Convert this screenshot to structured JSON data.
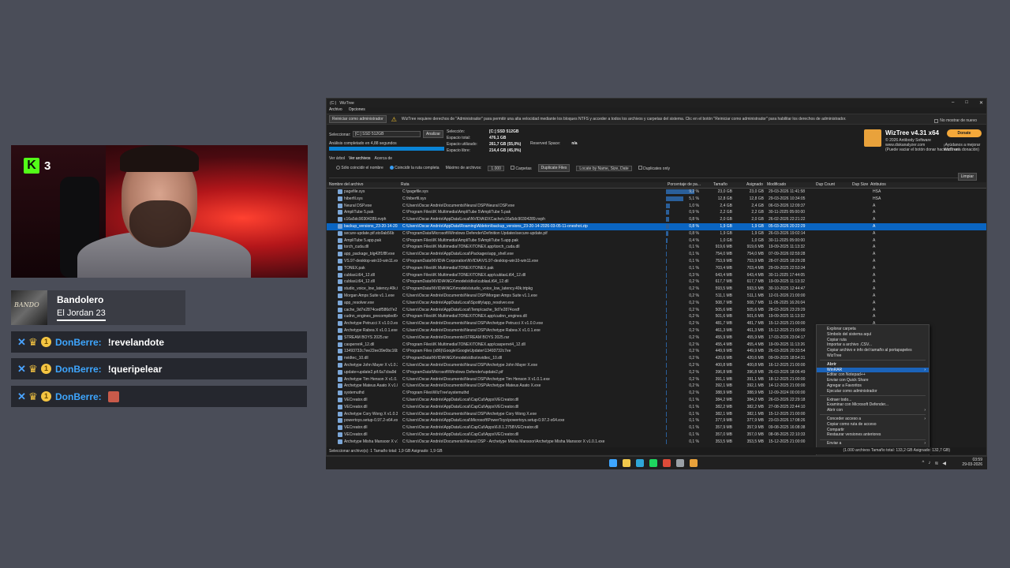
{
  "kick": {
    "count": "3",
    "logo": "K"
  },
  "music": {
    "title": "Bandolero",
    "artist": "El Jordan 23"
  },
  "chat": [
    {
      "user": "DonBerre:",
      "message": "!revelandote",
      "sub": "1"
    },
    {
      "user": "DonBerre:",
      "message": "!queripelear",
      "sub": "1"
    },
    {
      "user": "DonBerre:",
      "message": "",
      "sub": "1"
    }
  ],
  "window": {
    "title": "WizTree",
    "drive_short": "(C:)",
    "menu": [
      "Archivo",
      "Opciones"
    ],
    "admin_button": "Reiniciar como administrador",
    "admin_warning": "WizTree requiere derechos de \"Administrador\" para permitir una alta velocidad mediante los bloques NTFS y acceder a todos los archivos y carpetas del sistema. Clic en el botón \"Reiniciar como administrador\" para habilitar los derechos de administrador.",
    "no_show_again": "No mostrar de nuevo",
    "select_label": "Seleccionar:",
    "drive_value": "[C:] SSD 512GB",
    "analyze_button": "Analizar",
    "analysis_done": "Análisis completado en 4,88 segundos",
    "drive_info": [
      {
        "label": "Selección:",
        "value": "[C:] SSD 512GB"
      },
      {
        "label": "Espacio total:",
        "value": "476,1 GB"
      },
      {
        "label": "Espacio utilizado:",
        "value": "261,7 GB  (55,0%)"
      },
      {
        "label": "Espacio libre:",
        "value": "214,4 GB  (45,0%)"
      }
    ],
    "reserved_label": "Reserved Space:",
    "reserved_value": "n/a",
    "brand_title": "WizTree v4.31 x64",
    "brand_sub1": "© 2026 Antibody Software",
    "brand_sub2": "www.diskanalyzer.com",
    "brand_sub3": "(Puede vaciar el botón donar haciendo una donación)",
    "donate": "Donate",
    "donate_sub": "¡Ayúdanos a mejorar WizTree!",
    "tabs": [
      "Ver árbol",
      "Ver archivos",
      "Acerca de"
    ],
    "filter": {
      "only_name": "Sólo coincidir el nombre",
      "full_path": "Coincidir la ruta completa",
      "max_files_label": "Máximo de archivos:",
      "max_files": "1.000",
      "folders": "Carpetas",
      "duplicate_files": "Duplicate Files",
      "group_by": "Locate by Name, Size, Date",
      "only_duplicates": "Duplicates only"
    },
    "clear_button": "Limpiar",
    "columns": {
      "name": "Nombre del archivo",
      "path": "Ruta",
      "pct": "Porcentaje de pa...",
      "size": "Tamaño",
      "alloc": "Asignado",
      "modified": "Modificado",
      "dup": "Dup Count",
      "dupsize": "Dup Size",
      "attr": "Atributos"
    },
    "rows": [
      {
        "name": "pagefile.sys",
        "path": "C:\\pagefile.sys",
        "pct": "9,2 %",
        "size": "23,0 GB",
        "alloc": "23,0 GB",
        "modified": "29-03-2026 11:41:58",
        "attr": "HSA",
        "bar": 0.9
      },
      {
        "name": "hiberfil.sys",
        "path": "C:\\hiberfil.sys",
        "pct": "5,1 %",
        "size": "12,8 GB",
        "alloc": "12,8 GB",
        "modified": "29-03-2026 10:34:05",
        "attr": "HSA",
        "bar": 0.55
      },
      {
        "name": "Neural DSP.exe",
        "path": "C:\\Users\\Oscar Andrés\\Documents\\Neural DSP\\Neural DSP.exe",
        "pct": "1,0 %",
        "size": "2,4 GB",
        "alloc": "2,4 GB",
        "modified": "06-03-2026 12:09:37",
        "attr": "A",
        "bar": 0.12
      },
      {
        "name": "AmpliTube 5.pak",
        "path": "C:\\Program Files\\IK Multimedia\\AmpliTube 5\\AmpliTube 5.pak",
        "pct": "0,9 %",
        "size": "2,2 GB",
        "alloc": "2,2 GB",
        "modified": "30-11-2025 05:00:00",
        "attr": "A",
        "bar": 0.1
      },
      {
        "name": "c16a5dc90304289.nvph",
        "path": "C:\\Users\\Oscar Andrés\\AppData\\Local\\NVIDIA\\DXCache\\c16a5dc90304289.nvph",
        "pct": "0,8 %",
        "size": "2,0 GB",
        "alloc": "2,0 GB",
        "modified": "26-02-2026 22:21:22",
        "attr": "A",
        "bar": 0.09
      },
      {
        "name": "backup_versions_23-20-14-2026.zip",
        "path": "C:\\Users\\Oscar Andrés\\AppData\\Roaming\\Ableton\\backup_versions_23-20-14-2026-03-05-11-oneshot.zip",
        "pct": "0,8 %",
        "size": "1,9 GB",
        "alloc": "1,9 GB",
        "modified": "05-03-2026 20:22:29",
        "attr": "A",
        "bar": 0.09,
        "selected": true
      },
      {
        "name": "secure-update.pif.sto9ab56b",
        "path": "C:\\ProgramData\\Microsoft\\Windows Defender\\Definition Updates\\secure-update.pif",
        "pct": "0,8 %",
        "size": "1,9 GB",
        "alloc": "1,9 GB",
        "modified": "26-03-2026 19:02:14",
        "attr": "A",
        "bar": 0.08
      },
      {
        "name": "AmpliTube 5.app.pak",
        "path": "C:\\Program Files\\IK Multimedia\\AmpliTube 5\\AmpliTube 5.app.pak",
        "pct": "0,4 %",
        "size": "1,0 GB",
        "alloc": "1,0 GB",
        "modified": "30-11-2025 05:00:00",
        "attr": "A",
        "bar": 0.05
      },
      {
        "name": "torch_cuda.dll",
        "path": "C:\\Program Files\\IK Multimedia\\TONEX\\TONEX.app\\torch_cuda.dll",
        "pct": "0,1 %",
        "size": "919,6 MB",
        "alloc": "919,6 MB",
        "modified": "19-09-2025 11:13:32",
        "attr": "A",
        "bar": 0.03
      },
      {
        "name": "app_package_blg42f1f8f.exe",
        "path": "C:\\Users\\Oscar Andrés\\AppData\\Local\\Packages\\app_shell.exe",
        "pct": "0,1 %",
        "size": "754,0 MB",
        "alloc": "754,0 MB",
        "modified": "07-09-2026 02:59:28",
        "attr": "A",
        "bar": 0.03
      },
      {
        "name": "VS.97-desktop-win10-win11.exe",
        "path": "C:\\ProgramData\\NVIDIA Corporation\\NVIDIA\\VS.97-desktop-win10-win11.exe",
        "pct": "0,1 %",
        "size": "753,9 MB",
        "alloc": "753,9 MB",
        "modified": "28-07-2025 18:29:28",
        "attr": "A",
        "bar": 0.03
      },
      {
        "name": "TONEX.pak",
        "path": "C:\\Program Files\\IK Multimedia\\TONEX\\TONEX.pak",
        "pct": "0,1 %",
        "size": "703,4 MB",
        "alloc": "703,4 MB",
        "modified": "29-09-2025 22:53:34",
        "attr": "A",
        "bar": 0.03
      },
      {
        "name": "cublasLt64_12.dll",
        "path": "C:\\Program Files\\IK Multimedia\\TONEX\\TONEX.app\\cublasLt64_12.dll",
        "pct": "0,3 %",
        "size": "643,4 MB",
        "alloc": "643,4 MB",
        "modified": "30-11-2025 17:44:05",
        "attr": "A",
        "bar": 0.02
      },
      {
        "name": "cublasLt64_12.dll",
        "path": "C:\\ProgramData\\NVIDIA\\NGX\\models\\dlss\\cublasLt64_12.dll",
        "pct": "0,2 %",
        "size": "617,7 MB",
        "alloc": "617,7 MB",
        "modified": "19-09-2025 11:13:32",
        "attr": "A",
        "bar": 0.02
      },
      {
        "name": "studio_voice_low_latency.40k.trtpkg",
        "path": "C:\\ProgramData\\NVIDIA\\NGX\\models\\studio_voice_low_latency.40k.trtpkg",
        "pct": "0,2 %",
        "size": "593,5 MB",
        "alloc": "593,5 MB",
        "modified": "30-10-2025 12:44:47",
        "attr": "A",
        "bar": 0.02
      },
      {
        "name": "Morgan Amps Suite v1.1.exe",
        "path": "C:\\Users\\Oscar Andrés\\Documents\\Neural DSP\\Morgan Amps Suite v1.1.exe",
        "pct": "0,2 %",
        "size": "511,1 MB",
        "alloc": "511,1 MB",
        "modified": "12-01-2026 21:00:00",
        "attr": "A",
        "bar": 0.02
      },
      {
        "name": "app_resolver.exe",
        "path": "C:\\Users\\Oscar Andrés\\AppData\\Local\\Spotify\\app_resolver.exe",
        "pct": "0,2 %",
        "size": "508,7 MB",
        "alloc": "508,7 MB",
        "modified": "11-05-2025 16:26:04",
        "attr": "A",
        "bar": 0.02
      },
      {
        "name": "cache_9d7e2874cedf586d7e2",
        "path": "C:\\Users\\Oscar Andrés\\AppData\\Local\\Temp\\cache_9d7e2874cedf",
        "pct": "0,2 %",
        "size": "505,6 MB",
        "alloc": "505,6 MB",
        "modified": "28-03-2026 23:29:29",
        "attr": "A",
        "bar": 0.02
      },
      {
        "name": "cudnn_engines_precompiled64_9.dll",
        "path": "C:\\Program Files\\IK Multimedia\\TONEX\\TONEX.app\\cudnn_engines.dll",
        "pct": "0,2 %",
        "size": "501,6 MB",
        "alloc": "501,6 MB",
        "modified": "19-09-2025 11:13:32",
        "attr": "A",
        "bar": 0.02
      },
      {
        "name": "Archetype Petrucci X v1.0.0.exe",
        "path": "C:\\Users\\Oscar Andrés\\Documents\\Neural DSP\\Archetype Petrucci X v1.0.0.exe",
        "pct": "0,2 %",
        "size": "481,7 MB",
        "alloc": "481,7 MB",
        "modified": "15-12-2025 21:00:00",
        "attr": "A",
        "bar": 0.02
      },
      {
        "name": "Archetype Rabea X v1.0.1.exe",
        "path": "C:\\Users\\Oscar Andrés\\Documents\\Neural DSP\\Archetype Rabea X v1.0.1.exe",
        "pct": "0,2 %",
        "size": "461,3 MB",
        "alloc": "461,3 MB",
        "modified": "15-12-2025 21:00:00",
        "attr": "A",
        "bar": 0.02
      },
      {
        "name": "STREAM BOYS 2025.rar",
        "path": "C:\\Users\\Oscar Andrés\\Documents\\STREAM BOYS 2025.rar",
        "pct": "0,2 %",
        "size": "455,9 MB",
        "alloc": "455,9 MB",
        "modified": "17-03-2026 23:04:17",
        "attr": "A",
        "bar": 0.02
      },
      {
        "name": "casperret4_12.dll",
        "path": "C:\\Program Files\\IK Multimedia\\TONEX\\TONEX.app\\casperret4_12.dll",
        "pct": "0,2 %",
        "size": "455,4 MB",
        "alloc": "455,4 MB",
        "modified": "19-09-2025 11:13:26",
        "attr": "A",
        "bar": 0.02
      },
      {
        "name": "13493732c7ee22ee39e0bc16b",
        "path": "C:\\Program Files (x86)\\Google\\GoogleUpdater\\13493732c7ee",
        "pct": "0,2 %",
        "size": "449,9 MB",
        "alloc": "449,9 MB",
        "modified": "26-03-2026 20:33:54",
        "attr": "A",
        "bar": 0.02
      },
      {
        "name": "nvidtec_10.dll",
        "path": "C:\\ProgramData\\NVIDIA\\NGX\\models\\dlss\\nvidtec_10.dll",
        "pct": "0,2 %",
        "size": "420,6 MB",
        "alloc": "420,6 MB",
        "modified": "09-09-2025 18:54:31",
        "attr": "A",
        "bar": 0.02
      },
      {
        "name": "Archetype John Mayer X v1.0.3.exe",
        "path": "C:\\Users\\Oscar Andrés\\Documents\\Neural DSP\\Archetype John Mayer X.exe",
        "pct": "0,2 %",
        "size": "400,8 MB",
        "alloc": "400,8 MB",
        "modified": "16-12-2025 21:00:00",
        "attr": "A",
        "bar": 0.02
      },
      {
        "name": "update+update2.pif.6a7cba9d",
        "path": "C:\\ProgramData\\Microsoft\\Windows Defender\\update2.pif",
        "pct": "0,2 %",
        "size": "396,8 MB",
        "alloc": "396,8 MB",
        "modified": "26-03-2026 18:06:49",
        "attr": "A",
        "bar": 0.02
      },
      {
        "name": "Archetype Tim Henson X v1.0.1.exe",
        "path": "C:\\Users\\Oscar Andrés\\Documents\\Neural DSP\\Archetype Tim Henson X v1.0.1.exe",
        "pct": "0,2 %",
        "size": "391,1 MB",
        "alloc": "391,1 MB",
        "modified": "18-12-2025 21:00:00",
        "attr": "A",
        "bar": 0.02
      },
      {
        "name": "Archetype Mateus Asato X v1.0.3.exe",
        "path": "C:\\Users\\Oscar Andrés\\Documents\\Neural DSP\\Archetype Mateus Asato X.exe",
        "pct": "0,2 %",
        "size": "392,1 MB",
        "alloc": "392,1 MB",
        "modified": "14-12-2025 21:00:00",
        "attr": "A",
        "bar": 0.02
      },
      {
        "name": "systemuthd",
        "path": "C:\\Program Files\\WizTree\\systemuthd",
        "pct": "0,2 %",
        "size": "388,9 MB",
        "alloc": "388,9 MB",
        "modified": "12-09-2024 00:00:00",
        "attr": "A",
        "bar": 0.02
      },
      {
        "name": "VECreator.dll",
        "path": "C:\\Users\\Oscar Andrés\\AppData\\Local\\CapCut\\Apps\\VECreator.dll",
        "pct": "0,1 %",
        "size": "384,2 MB",
        "alloc": "384,2 MB",
        "modified": "26-03-2026 22:29:18",
        "attr": "A",
        "bar": 0.01
      },
      {
        "name": "VECreator.dll",
        "path": "C:\\Users\\Oscar Andrés\\AppData\\Local\\CapCut\\Apps\\VECreator.dll",
        "pct": "0,1 %",
        "size": "382,2 MB",
        "alloc": "382,2 MB",
        "modified": "27-08-2025 22:44:10",
        "attr": "A",
        "bar": 0.01
      },
      {
        "name": "Archetype Cory Wong X v1.0.3.exe",
        "path": "C:\\Users\\Oscar Andrés\\Documents\\Neural DSP\\Archetype Cory Wong X.exe",
        "pct": "0,1 %",
        "size": "382,1 MB",
        "alloc": "382,1 MB",
        "modified": "15-12-2025 21:00:00",
        "attr": "A",
        "bar": 0.01
      },
      {
        "name": "powertoys.setup-0.97.2-x64.exe",
        "path": "C:\\Users\\Oscar Andrés\\AppData\\Local\\Microsoft\\PowerToys\\powertoys.setup-0.97.2-x64.exe",
        "pct": "0,1 %",
        "size": "377,9 MB",
        "alloc": "377,9 MB",
        "modified": "23-03-2026 17:08:26",
        "attr": "A",
        "bar": 0.01
      },
      {
        "name": "VECreator.dll",
        "path": "C:\\Users\\Oscar Andrés\\AppData\\Local\\CapCut\\Apps\\6.8.1.2758\\VECreator.dll",
        "pct": "0,1 %",
        "size": "357,9 MB",
        "alloc": "357,9 MB",
        "modified": "09-08-2025 16:08:38",
        "attr": "A",
        "bar": 0.01
      },
      {
        "name": "VECreator.dll",
        "path": "C:\\Users\\Oscar Andrés\\AppData\\Local\\CapCut\\Apps\\VECreator.dll",
        "pct": "0,1 %",
        "size": "357,0 MB",
        "alloc": "357,0 MB",
        "modified": "08-08-2025 22:10:33",
        "attr": "A",
        "bar": 0.01
      },
      {
        "name": "Archetype Misha Mansoor X v1.0.1.exe",
        "path": "C:\\Users\\Oscar Andrés\\Documents\\Neural DSP - Archetype Misha Mansoor\\Archetype Misha Mansoor X v1.0.1.exe",
        "pct": "0,1 %",
        "size": "353,5 MB",
        "alloc": "353,5 MB",
        "modified": "15-12-2025 21:00:00",
        "attr": "A",
        "bar": 0.01
      }
    ],
    "context_menu": [
      {
        "label": "Explorar carpeta"
      },
      {
        "label": "Símbolo del sistema aquí"
      },
      {
        "label": "Copiar ruta"
      },
      {
        "label": "Importar a archivo .CSV..."
      },
      {
        "label": "Copiar archivo e info del tamaño al portapapeles"
      },
      {
        "label": "WizTree"
      },
      {
        "sep": true
      },
      {
        "label": "Abrir",
        "bold": true
      },
      {
        "label": "WinRAR",
        "highlight": true,
        "submenu": true
      },
      {
        "label": "Editar con Notepad++"
      },
      {
        "label": "Enviar con Quick Share"
      },
      {
        "label": "Agregar a Favoritos"
      },
      {
        "label": "Ejecutar como administrador"
      },
      {
        "sep": true
      },
      {
        "label": "Extraer todo..."
      },
      {
        "label": "Examinar con Microsoft Defender..."
      },
      {
        "label": "Abrir con",
        "submenu": true
      },
      {
        "sep": true
      },
      {
        "label": "Conceder acceso a",
        "submenu": true
      },
      {
        "label": "Copiar como ruta de acceso"
      },
      {
        "label": "Compartir"
      },
      {
        "label": "Restaurar versiones anteriores"
      },
      {
        "sep": true
      },
      {
        "label": "Enviar a",
        "submenu": true
      },
      {
        "sep": true
      },
      {
        "label": "Cortar"
      },
      {
        "label": "Copiar"
      },
      {
        "sep": true
      },
      {
        "label": "Crear acceso directo"
      },
      {
        "label": "Eliminar"
      },
      {
        "sep": true
      },
      {
        "label": "Propiedades"
      }
    ],
    "status_left": "Seleccionar archivo(s): 1   Tamaño total: 1,9 GB   Asignado: 1,9 GB",
    "status_right": "(1.000 archivos   Tamaño total: 133,2 GB   Asignado: 132,7 GB)"
  },
  "taskbar": {
    "time": "03:59",
    "date": "29-03-2026",
    "apps": [
      {
        "name": "windows-start",
        "color": "#3ea6ff"
      },
      {
        "name": "file-explorer",
        "color": "#f2c94c"
      },
      {
        "name": "edge",
        "color": "#2fa7d8"
      },
      {
        "name": "spotify",
        "color": "#1ed760"
      },
      {
        "name": "chrome",
        "color": "#dd4b39"
      },
      {
        "name": "settings",
        "color": "#9aa0a6"
      },
      {
        "name": "wiztree",
        "color": "#e9a23b"
      }
    ]
  },
  "colors": {
    "kick_green": "#53fc18",
    "chat_user": "#3ea6ff",
    "selection": "#0a65c2",
    "progress": "#0a84d6"
  }
}
